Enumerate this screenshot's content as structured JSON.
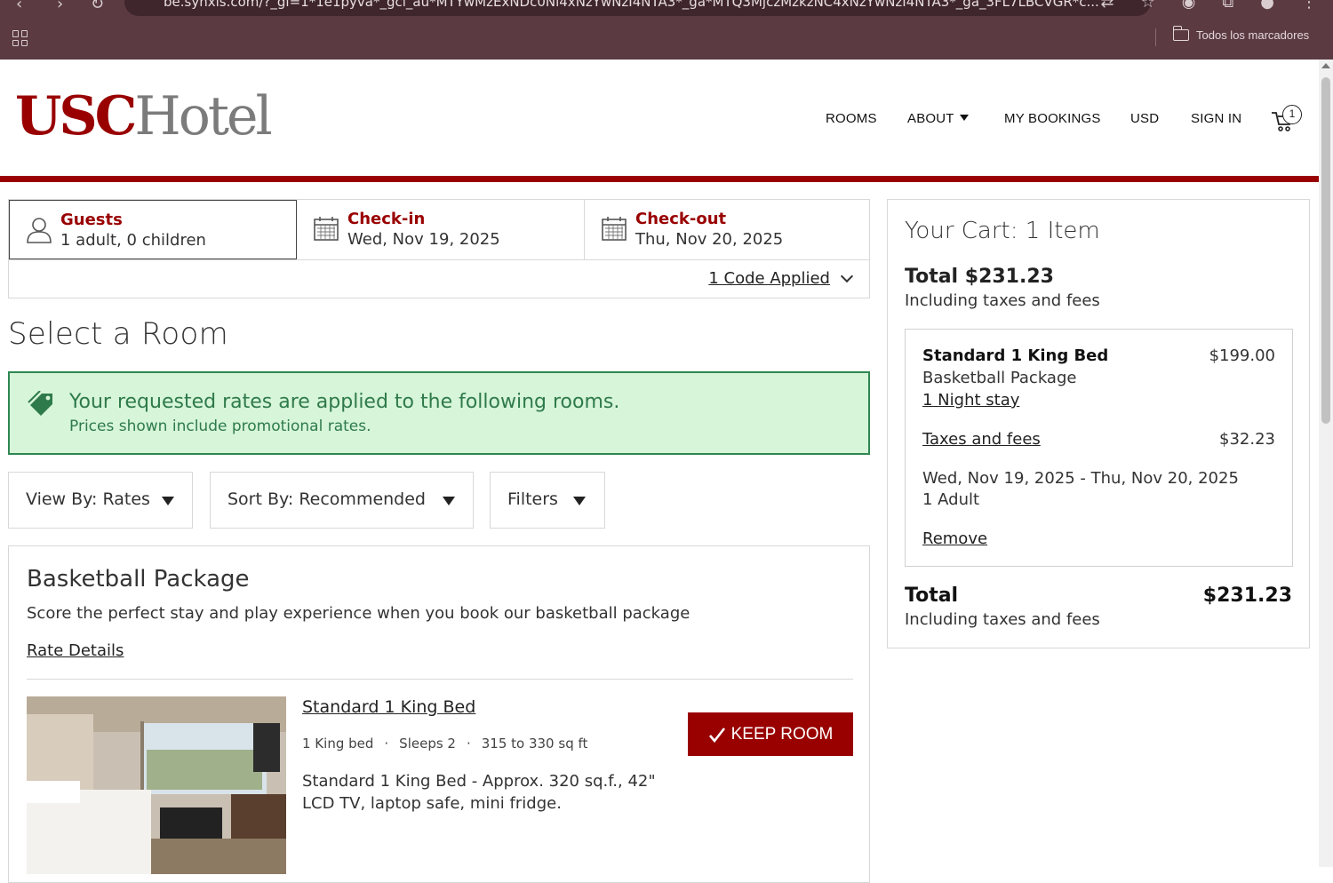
{
  "browser": {
    "url": "be.synxis.com/?_gl=1*1e1pyva*_gcl_au*MTYwMzExNDc0Ni4xNzYwNzI4NTA3*_ga*MTQ3MjczMzkzNC4xNzYwNzI4NTA3*_ga_3FL7LBCVGR*c...",
    "bookmarks_label": "Todos los marcadores"
  },
  "header": {
    "logo_bold": "USC",
    "logo_light": "Hotel",
    "nav": {
      "rooms": "ROOMS",
      "about": "ABOUT",
      "my_bookings": "MY BOOKINGS",
      "currency": "USD",
      "sign_in": "SIGN IN"
    },
    "cart_count": "1"
  },
  "search": {
    "guests_label": "Guests",
    "guests_value": "1 adult, 0 children",
    "checkin_label": "Check-in",
    "checkin_value": "Wed, Nov 19, 2025",
    "checkout_label": "Check-out",
    "checkout_value": "Thu, Nov 20, 2025",
    "codes_applied": "1 Code Applied"
  },
  "main": {
    "title": "Select a Room",
    "alert": {
      "main": "Your requested rates are applied to the following rooms.",
      "sub": "Prices shown include promotional rates."
    },
    "filters": {
      "view_by": "View By: Rates",
      "sort_by": "Sort By: Recommended",
      "filters": "Filters"
    },
    "rate": {
      "title": "Basketball Package",
      "description": "Score the perfect stay and play experience when you book our basketball package",
      "details_link": "Rate Details",
      "room": {
        "name": "Standard 1 King Bed",
        "beds": "1 King bed",
        "sleeps": "Sleeps 2",
        "size": "315 to 330 sq ft",
        "description": "Standard 1 King Bed - Approx. 320 sq.f., 42\" LCD TV, laptop safe, mini fridge.",
        "keep_button": "KEEP ROOM"
      }
    }
  },
  "cart": {
    "title": "Your Cart: 1 Item",
    "total_label": "Total $231.23",
    "including": "Including taxes and fees",
    "item": {
      "name": "Standard 1 King Bed",
      "price": "$199.00",
      "package": "Basketball Package",
      "nights": "1 Night stay",
      "taxes_label": "Taxes and fees",
      "taxes_value": "$32.23",
      "dates": "Wed, Nov 19, 2025 - Thu, Nov 20, 2025",
      "adults": "1 Adult",
      "remove": "Remove"
    },
    "footer_label": "Total",
    "footer_value": "$231.23",
    "footer_including": "Including taxes and fees"
  },
  "colors": {
    "brand": "#990000",
    "chrome": "#5b3a42",
    "alert_bg": "#d6f5d9",
    "alert_text": "#2f7a4a"
  }
}
